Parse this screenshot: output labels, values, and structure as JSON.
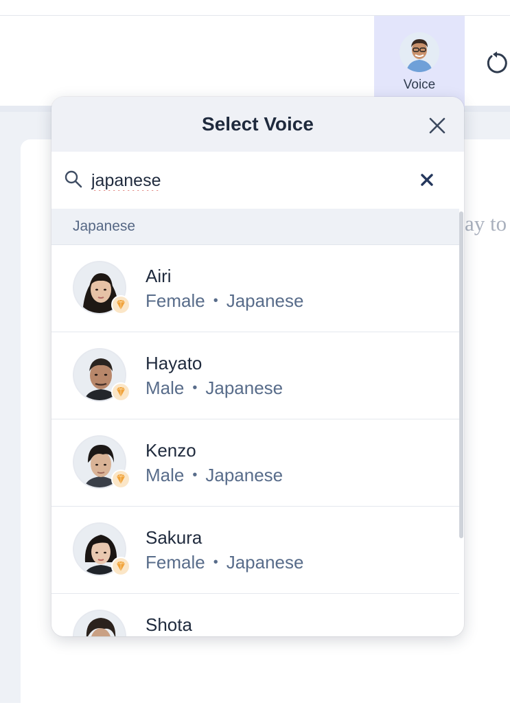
{
  "toolbar": {
    "voice_label": "Voice"
  },
  "document": {
    "visible_text": "ay to"
  },
  "modal": {
    "title": "Select Voice",
    "search": {
      "value": "japanese"
    },
    "section_label": "Japanese",
    "voices": [
      {
        "name": "Airi",
        "gender": "Female",
        "language": "Japanese",
        "premium": true
      },
      {
        "name": "Hayato",
        "gender": "Male",
        "language": "Japanese",
        "premium": true
      },
      {
        "name": "Kenzo",
        "gender": "Male",
        "language": "Japanese",
        "premium": true
      },
      {
        "name": "Sakura",
        "gender": "Female",
        "language": "Japanese",
        "premium": true
      },
      {
        "name": "Shota",
        "gender": "",
        "language": "",
        "premium": false
      }
    ],
    "meta_separator": "•"
  },
  "colors": {
    "voice_button_bg": "#e3e5fb",
    "title_text": "#1f2a3d",
    "meta_text": "#586c8a",
    "premium_badge": "#f0a23a"
  }
}
